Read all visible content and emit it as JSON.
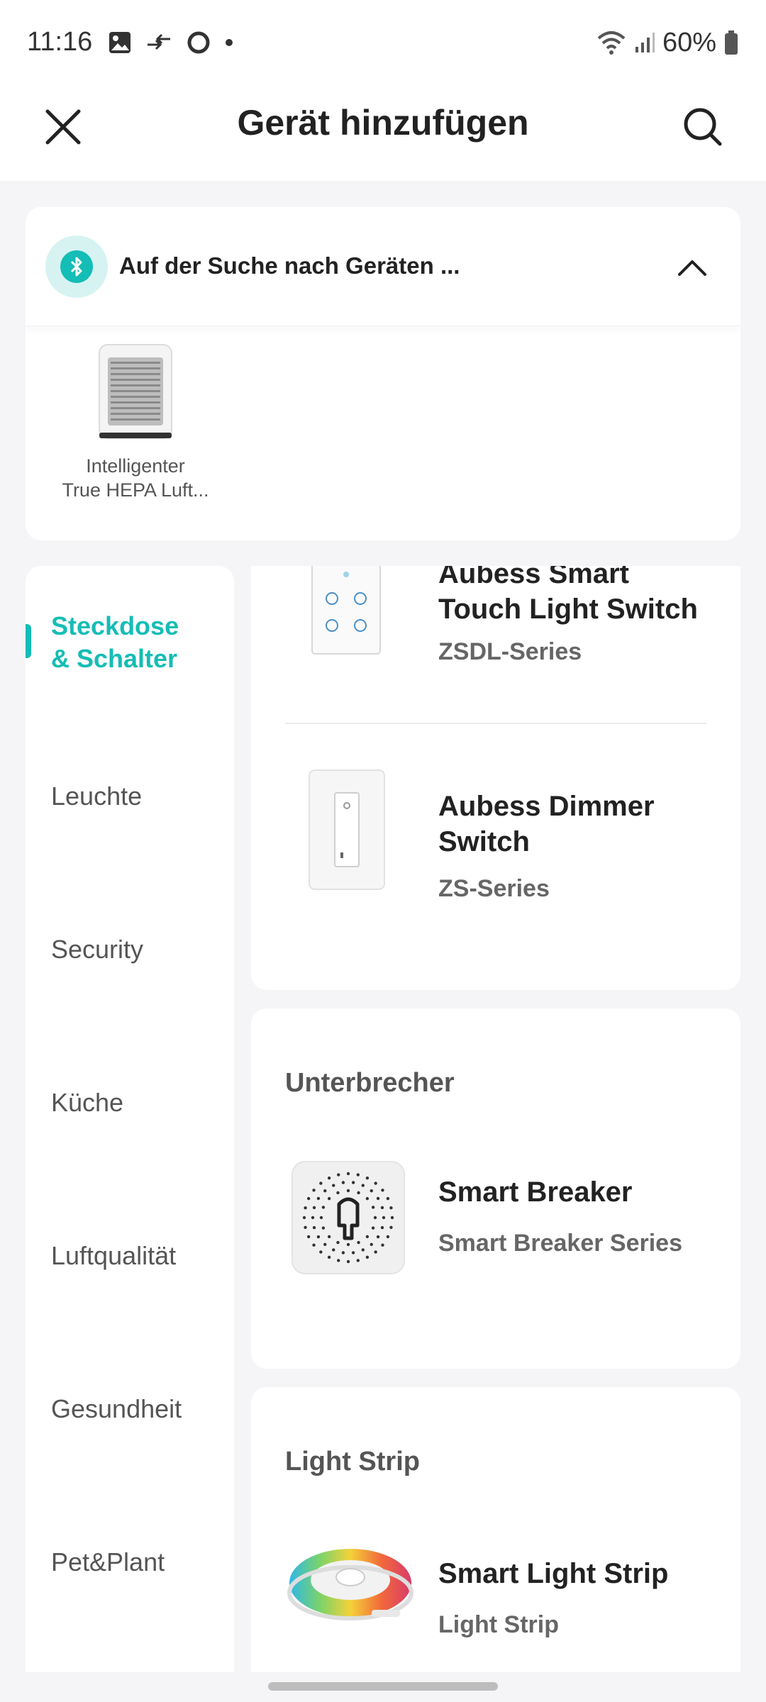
{
  "status_bar": {
    "time": "11:16",
    "battery": "60%"
  },
  "header": {
    "title": "Gerät hinzufügen",
    "close_icon": "close-icon",
    "search_icon": "search-icon"
  },
  "scan": {
    "text": "Auf der Suche nach Geräten ...",
    "icon": "bluetooth-icon",
    "accent_color": "#14bdb5",
    "found_devices": [
      {
        "label_line1": "Intelligenter",
        "label_line2": "True HEPA Luft..."
      }
    ]
  },
  "sidebar": {
    "items": [
      {
        "label_line1": "Steckdose",
        "label_line2": "& Schalter",
        "active": true
      },
      {
        "label": "Leuchte"
      },
      {
        "label": "Security"
      },
      {
        "label": "Küche"
      },
      {
        "label": "Luftqualität"
      },
      {
        "label": "Gesundheit"
      },
      {
        "label": "Pet&Plant"
      }
    ]
  },
  "content": {
    "switch_card": {
      "devices": [
        {
          "name_line1": "Aubess Smart",
          "name_line2": "Touch Light Switch",
          "series": "ZSDL-Series"
        },
        {
          "name_line1": "Aubess Dimmer",
          "name_line2": "Switch",
          "series": "ZS-Series"
        }
      ]
    },
    "breaker_card": {
      "title": "Unterbrecher",
      "device": {
        "name": "Smart Breaker",
        "series": "Smart Breaker Series"
      }
    },
    "strip_card": {
      "title": "Light Strip",
      "device": {
        "name": "Smart Light Strip",
        "series": "Light Strip"
      }
    }
  }
}
